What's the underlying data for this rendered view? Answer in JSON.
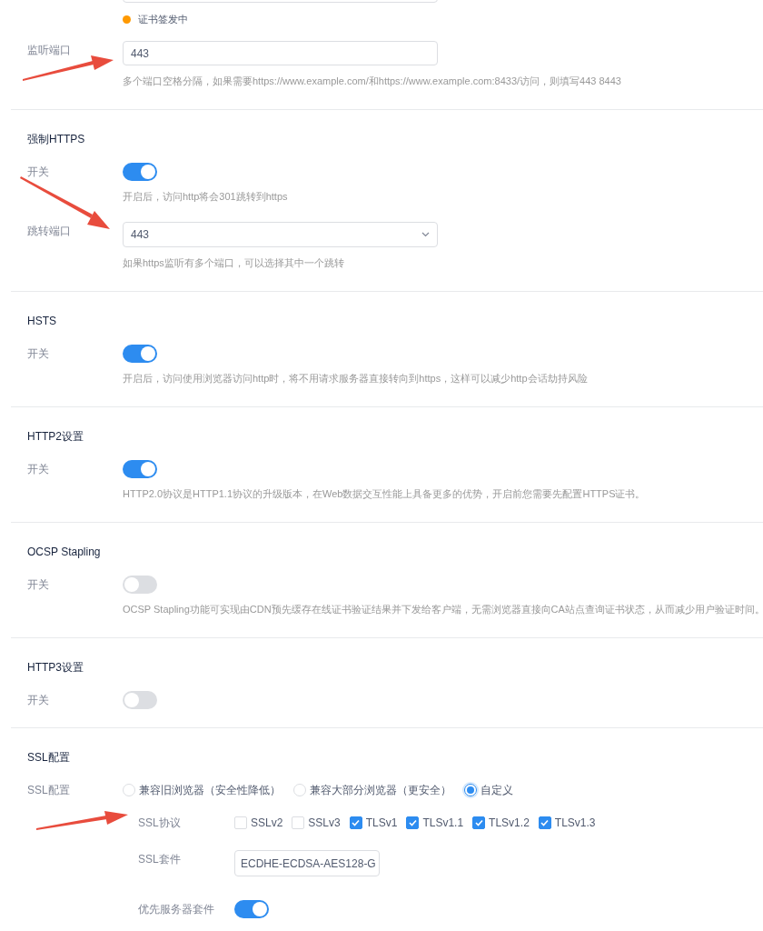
{
  "status": {
    "text": "证书签发中",
    "color": "#ff9900"
  },
  "sections": [
    {
      "rows": [
        {
          "kind": "input",
          "label": "监听端口",
          "value": "443",
          "hint": "多个端口空格分隔，如果需要https://www.example.com/和https://www.example.com:8433/访问，则填写443 8443"
        }
      ]
    },
    {
      "title": "强制HTTPS",
      "rows": [
        {
          "kind": "switch",
          "label": "开关",
          "on": true,
          "hint": "开启后，访问http将会301跳转到https"
        },
        {
          "kind": "select",
          "label": "跳转端口",
          "value": "443",
          "hint": "如果https监听有多个端口，可以选择其中一个跳转"
        }
      ]
    },
    {
      "title": "HSTS",
      "rows": [
        {
          "kind": "switch",
          "label": "开关",
          "on": true,
          "hint": "开启后，访问使用浏览器访问http时，将不用请求服务器直接转向到https，这样可以减少http会话劫持风险"
        }
      ]
    },
    {
      "title": "HTTP2设置",
      "rows": [
        {
          "kind": "switch",
          "label": "开关",
          "on": true,
          "hint": "HTTP2.0协议是HTTP1.1协议的升级版本，在Web数据交互性能上具备更多的优势，开启前您需要先配置HTTPS证书。"
        }
      ]
    },
    {
      "title": "OCSP Stapling",
      "rows": [
        {
          "kind": "switch",
          "label": "开关",
          "on": false,
          "hint": "OCSP Stapling功能可实现由CDN预先缓存在线证书验证结果并下发给客户端，无需浏览器直接向CA站点查询证书状态，从而减少用户验证时间。"
        }
      ]
    },
    {
      "title": "HTTP3设置",
      "rows": [
        {
          "kind": "switch",
          "label": "开关",
          "on": false
        }
      ]
    },
    {
      "title": "SSL配置",
      "rows": [
        {
          "kind": "radio",
          "label": "SSL配置",
          "options": [
            {
              "label": "兼容旧浏览器（安全性降低）",
              "selected": false
            },
            {
              "label": "兼容大部分浏览器（更安全）",
              "selected": false
            },
            {
              "label": "自定义",
              "selected": true
            }
          ]
        },
        {
          "kind": "checkboxes",
          "sub": true,
          "label": "SSL协议",
          "options": [
            {
              "label": "SSLv2",
              "checked": false
            },
            {
              "label": "SSLv3",
              "checked": false
            },
            {
              "label": "TLSv1",
              "checked": true
            },
            {
              "label": "TLSv1.1",
              "checked": true
            },
            {
              "label": "TLSv1.2",
              "checked": true
            },
            {
              "label": "TLSv1.3",
              "checked": true
            }
          ]
        },
        {
          "kind": "input-narrow",
          "sub": true,
          "label": "SSL套件",
          "value": "ECDHE-ECDSA-AES128-G"
        },
        {
          "kind": "switch",
          "sub": true,
          "label": "优先服务器套件",
          "on": true
        }
      ]
    }
  ]
}
